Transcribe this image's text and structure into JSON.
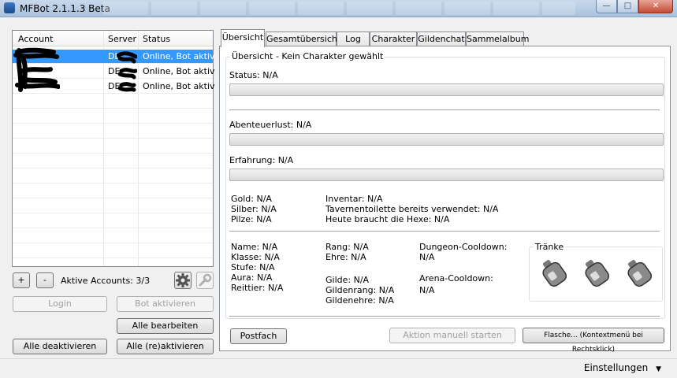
{
  "window": {
    "title": "MFBot 2.1.1.3 Beta",
    "minimize": "—",
    "maximize": "□",
    "close": "✕"
  },
  "accounts": {
    "columns": {
      "account": "Account",
      "server": "Server",
      "status": "Status"
    },
    "rows": [
      {
        "account": "",
        "server": "DE",
        "status": "Online, Bot aktiv",
        "selected": true
      },
      {
        "account": "",
        "server": "DE",
        "status": "Online, Bot aktiv",
        "selected": false
      },
      {
        "account": "",
        "server": "DE",
        "status": "Online, Bot aktiv",
        "selected": false
      }
    ],
    "add_label": "+",
    "remove_label": "-",
    "active_accounts_label": "Aktive Accounts: 3/3",
    "icons": {
      "settings": "gear-icon",
      "tools": "wrench-icon"
    }
  },
  "buttons": {
    "login": "Login",
    "bot_aktivieren": "Bot aktivieren",
    "alle_bearbeiten": "Alle bearbeiten",
    "alle_deaktivieren": "Alle deaktivieren",
    "alle_reaktivieren": "Alle (re)aktivieren",
    "postfach": "Postfach",
    "aktion_manuell": "Aktion manuell starten",
    "flasche": "Flasche... (Kontextmenü bei Rechtsklick)"
  },
  "tabs": [
    "Übersicht",
    "Gesamtübersicht",
    "Log",
    "Charakter",
    "Gildenchat",
    "Sammelalbum"
  ],
  "overview": {
    "group_title": "Übersicht - Kein Charakter gewählt",
    "status": "Status: N/A",
    "abenteuerlust": "Abenteuerlust: N/A",
    "erfahrung": "Erfahrung: N/A",
    "gold": "Gold: N/A",
    "silber": "Silber: N/A",
    "pilze": "Pilze: N/A",
    "inventar": "Inventar: N/A",
    "taverne": "Tavernentoilette bereits verwendet: N/A",
    "hexe": "Heute braucht die Hexe: N/A",
    "name": "Name: N/A",
    "klasse": "Klasse: N/A",
    "stufe": "Stufe: N/A",
    "aura": "Aura: N/A",
    "reittier": "Reittier: N/A",
    "rang": "Rang: N/A",
    "ehre": "Ehre: N/A",
    "gilde": "Gilde: N/A",
    "gildenrang": "Gildenrang: N/A",
    "gildenehre": "Gildenehre: N/A",
    "dungeon_label": "Dungeon-Cooldown:",
    "dungeon_value": "N/A",
    "arena_label": "Arena-Cooldown:",
    "arena_value": "N/A",
    "traenke_title": "Tränke",
    "potions": [
      "potion-bottle-icon",
      "potion-bottle-icon",
      "potion-bottle-icon"
    ]
  },
  "statusbar": {
    "settings": "Einstellungen",
    "dropdown_icon": "▼"
  },
  "colors": {
    "selection": "#3399ff",
    "titlebar": "#a9c1dc",
    "panel": "#ffffff"
  }
}
